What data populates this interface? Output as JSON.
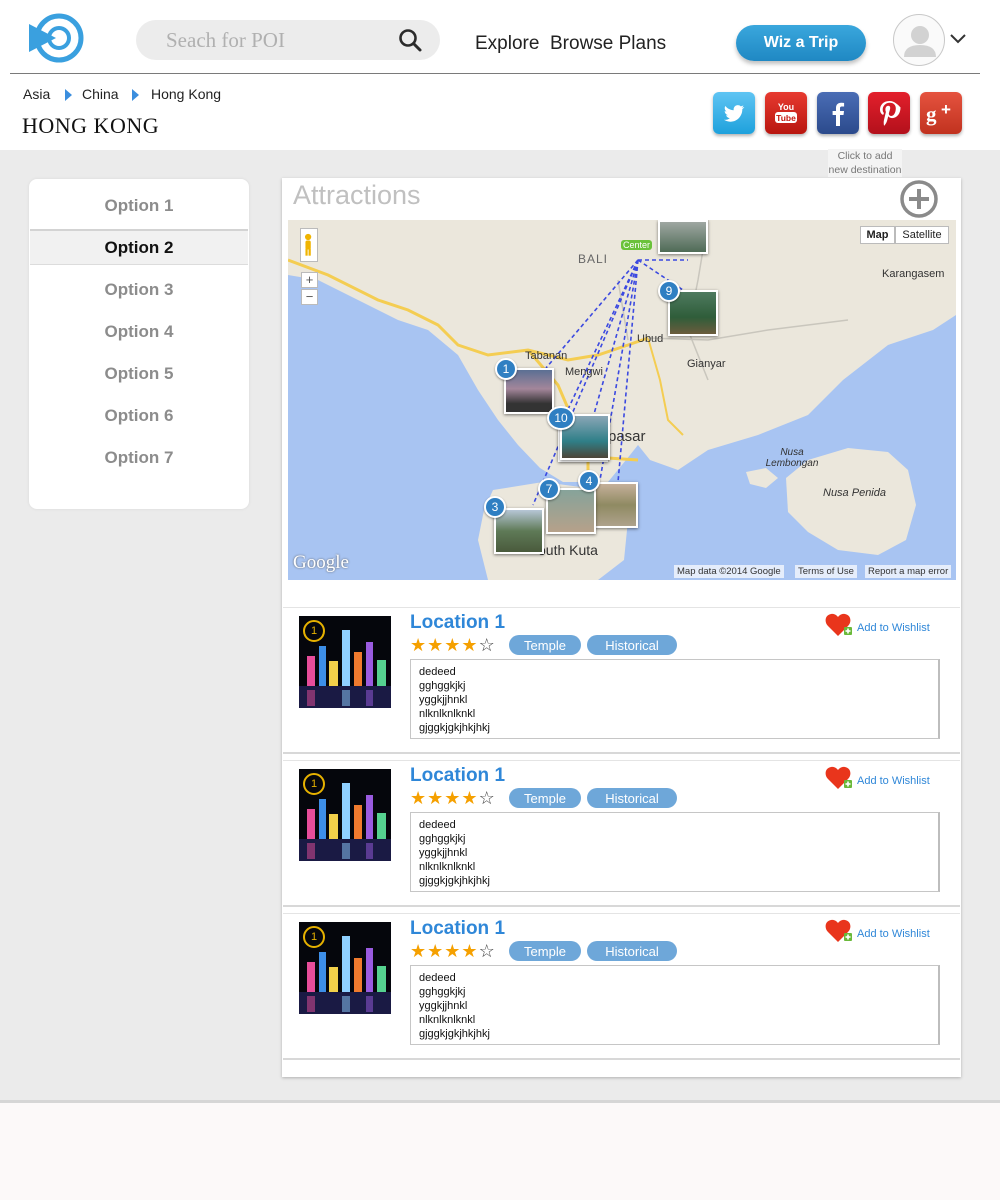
{
  "header": {
    "search_placeholder": "Seach for POI",
    "nav": [
      "Explore",
      "Browse Plans"
    ],
    "cta_label": "Wiz a Trip"
  },
  "breadcrumb": [
    "Asia",
    "China",
    "Hong Kong"
  ],
  "page_title": "HONG KONG",
  "social": [
    "twitter",
    "youtube",
    "facebook",
    "pinterest",
    "google-plus"
  ],
  "sidebar": {
    "options": [
      "Option 1",
      "Option 2",
      "Option 3",
      "Option 4",
      "Option 5",
      "Option 6",
      "Option 7"
    ],
    "active_index": 1
  },
  "attractions": {
    "title": "Attractions",
    "add_hint": "Click to add new destination"
  },
  "map": {
    "type_buttons": [
      "Map",
      "Satellite"
    ],
    "zoom_in": "+",
    "zoom_out": "−",
    "labels": [
      "BALI",
      "Karangasem",
      "Ubud",
      "Gianyar",
      "Tabanan",
      "Mengwi",
      "pasar",
      "outh Kuta",
      "Nusa Lembongan",
      "Nusa Penida",
      "Center"
    ],
    "pins": [
      "1",
      "10",
      "9",
      "7",
      "4",
      "3"
    ],
    "attribution": "Map data ©2014 Google",
    "terms": "Terms of Use",
    "report": "Report a map error",
    "google_logo": "Google"
  },
  "locations": [
    {
      "number": "1",
      "name": "Location 1",
      "rating": 4,
      "tags": [
        "Temple",
        "Historical"
      ],
      "wishlist_label": "Add to Wishlist",
      "description": "dedeed\ngghggkjkj\nyggkjjhnkl\nnlknlknlknkl\ngjggkjgkjhkjhkj"
    },
    {
      "number": "1",
      "name": "Location 1",
      "rating": 4,
      "tags": [
        "Temple",
        "Historical"
      ],
      "wishlist_label": "Add to Wishlist",
      "description": "dedeed\ngghggkjkj\nyggkjjhnkl\nnlknlknlknkl\ngjggkjgkjhkjhkj"
    },
    {
      "number": "1",
      "name": "Location 1",
      "rating": 4,
      "tags": [
        "Temple",
        "Historical"
      ],
      "wishlist_label": "Add to Wishlist",
      "description": "dedeed\ngghggkjkj\nyggkjjhnkl\nnlknlknlknkl\ngjggkjgkjhkjhkj"
    }
  ],
  "colors": {
    "accent": "#2f87d8",
    "cta": "#2a97d1",
    "tag": "#6ea7d9",
    "star": "#f5a000",
    "background": "#ebebeb"
  }
}
